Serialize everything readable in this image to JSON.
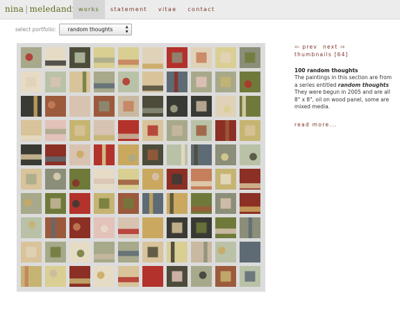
{
  "header": {
    "logo": {
      "first": "nina",
      "separator": "|",
      "last": "meledandri"
    },
    "nav": [
      {
        "label": "works",
        "active": true
      },
      {
        "label": "statement",
        "active": false
      },
      {
        "label": "vitae",
        "active": false
      },
      {
        "label": "contact",
        "active": false
      }
    ]
  },
  "portfolio": {
    "label": "select portfolio:",
    "selected": "random thoughts"
  },
  "pager": {
    "prev": "prev",
    "next": "next",
    "thumbnails": "thumbnails [64]",
    "prev_icon": "left-arrow-icon",
    "next_icon": "right-arrow-icon"
  },
  "description": {
    "title": "100 random thoughts",
    "line1": "The paintings in this section are from a series entitled",
    "series_name": "random thoughts",
    "line2": "They were begun in 2005 and are all 8\" x 8\", oil on wood panel, some are mixed media.",
    "read_more": "read more..."
  },
  "colors": {
    "nav_link": "#7a3327",
    "nav_active": "#5d6d1e",
    "wall": "#dcdcdc",
    "tile_palette": [
      "#c9b9a0",
      "#d8c39a",
      "#b3322b",
      "#e0d2b8",
      "#6f7a3a",
      "#c6b472",
      "#8c2f24",
      "#d7c3b0",
      "#4d4b3a",
      "#a7a98a",
      "#e6dcc6",
      "#c57f5a",
      "#5e6b74",
      "#d9cf93",
      "#9c5a3c",
      "#b9c2a6",
      "#e3c2ba",
      "#3a3a35",
      "#caa860",
      "#8b8e78"
    ]
  }
}
